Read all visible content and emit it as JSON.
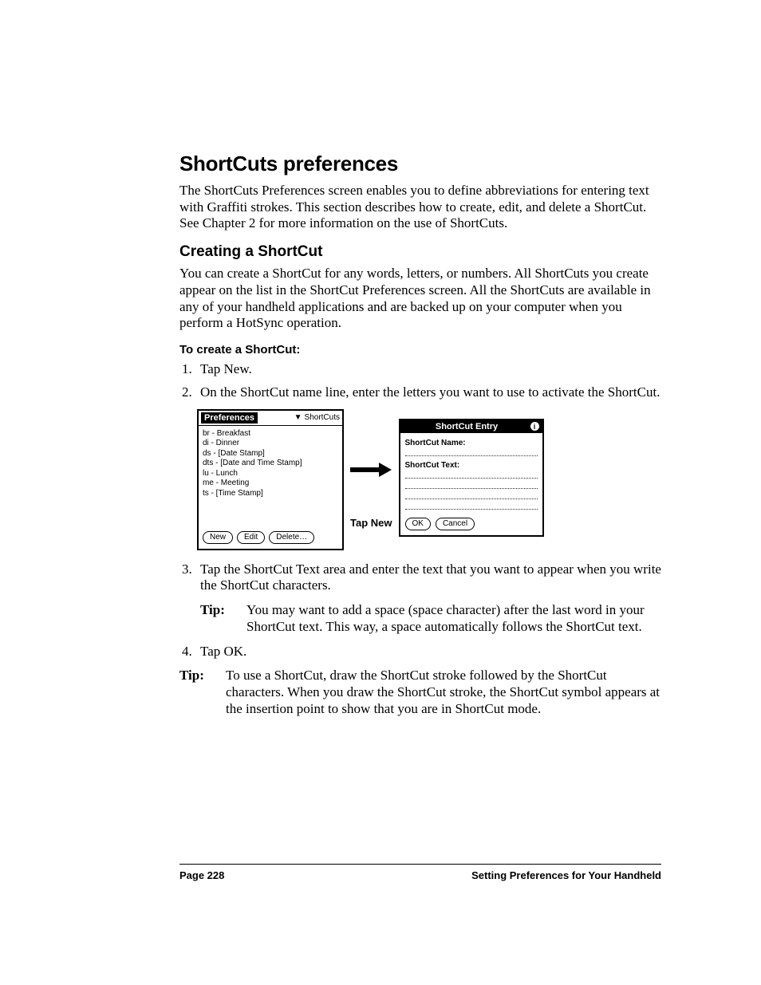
{
  "heading": "ShortCuts preferences",
  "intro": "The ShortCuts Preferences screen enables you to define abbreviations for entering text with Graffiti strokes. This section describes how to create, edit, and delete a ShortCut. See Chapter 2 for more information on the use of ShortCuts.",
  "sub1": "Creating a ShortCut",
  "sub1_body": "You can create a ShortCut for any words, letters, or numbers. All ShortCuts you create appear on the list in the ShortCut Preferences screen. All the ShortCuts are available in any of your handheld applications and are backed up on your computer when you perform a HotSync operation.",
  "howto_heading": "To create a ShortCut:",
  "steps": [
    "Tap New.",
    "On the ShortCut name line, enter the letters you want to use to activate the ShortCut.",
    "Tap the ShortCut Text area and enter the text that you want to appear when you write the ShortCut characters.",
    "Tap OK."
  ],
  "tip1_label": "Tip:",
  "tip1_text": "You may want to add a space (space character) after the last word in your ShortCut text. This way, a space automatically follows the ShortCut text.",
  "tip2_label": "Tip:",
  "tip2_text": "To use a ShortCut, draw the ShortCut stroke followed by the ShortCut characters. When you draw the ShortCut stroke, the ShortCut symbol appears at the insertion point to show that you are in ShortCut mode.",
  "figure": {
    "prefs_title": "Preferences",
    "menu_label": "ShortCuts",
    "list": [
      "br - Breakfast",
      "di - Dinner",
      "ds - [Date Stamp]",
      "dts - [Date and Time Stamp]",
      "lu - Lunch",
      "me - Meeting",
      "ts - [Time Stamp]"
    ],
    "btn_new": "New",
    "btn_edit": "Edit",
    "btn_delete": "Delete…",
    "tap_label": "Tap New",
    "dialog_title": "ShortCut Entry",
    "field_name": "ShortCut Name:",
    "field_text": "ShortCut Text:",
    "btn_ok": "OK",
    "btn_cancel": "Cancel"
  },
  "footer_left": "Page 228",
  "footer_right": "Setting Preferences for Your Handheld"
}
